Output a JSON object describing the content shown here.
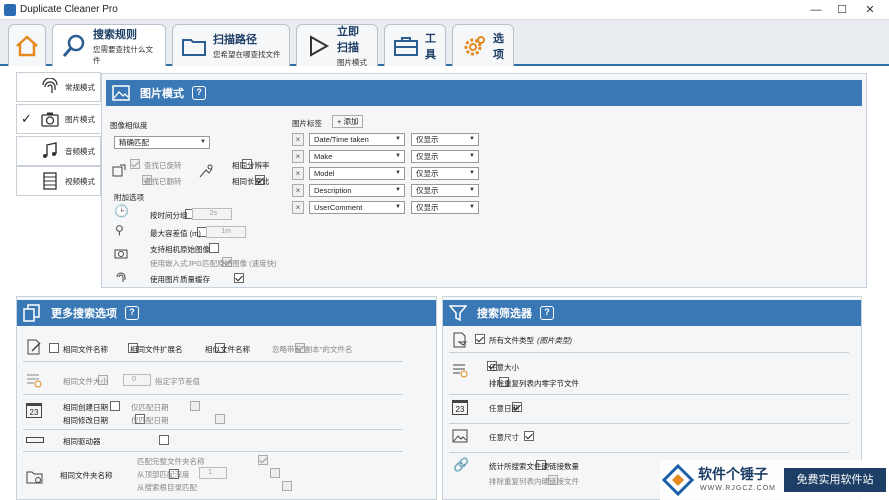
{
  "window": {
    "title": "Duplicate Cleaner Pro",
    "min": "—",
    "max": "☐",
    "close": "✕"
  },
  "tabs": [
    {
      "name": "",
      "sub": ""
    },
    {
      "name": "搜索规则",
      "sub": "您需要查找什么文件"
    },
    {
      "name": "扫描路径",
      "sub": "您希望在哪查找文件"
    },
    {
      "name": "立即扫描",
      "sub": "图片模式"
    },
    {
      "name": "工具",
      "sub": ""
    },
    {
      "name": "选项",
      "sub": ""
    }
  ],
  "modes": [
    "常规模式",
    "图片模式",
    "音频模式",
    "视频模式"
  ],
  "image_panel": {
    "title": "图片模式",
    "similarity_label": "图像相似度",
    "similarity_value": "精确匹配",
    "find_rotated": "查找已旋转",
    "find_flipped": "查找已翻转",
    "same_resolution": "相同分辨率",
    "same_aspect": "相同长宽比",
    "extra_label": "附加选项",
    "time_group": "按时间分组",
    "time_value": "2s",
    "max_distance": "最大容差值 (m)",
    "distance_value": "1m",
    "camera_raw": "支持相机原始图像",
    "embedded_jpg": "使用嵌入式JPG匹配原始图像 (速度快)",
    "cache": "使用图片质量缓存",
    "tags_label": "图片标签",
    "add_label": "+ 添加",
    "tags": [
      {
        "tag": "Date/Time taken",
        "mode": "仅显示"
      },
      {
        "tag": "Make",
        "mode": "仅显示"
      },
      {
        "tag": "Model",
        "mode": "仅显示"
      },
      {
        "tag": "Description",
        "mode": "仅显示"
      },
      {
        "tag": "UserComment",
        "mode": "仅显示"
      }
    ]
  },
  "more_panel": {
    "title": "更多搜索选项",
    "same_name": "相同文件名称",
    "same_ext": "相同文件扩展名",
    "similar_name": "相似文件名称",
    "ignore_copy": "忽略带有\"副本\"的文件名",
    "same_size": "相同文件大小",
    "size_value": "0",
    "size_diff": "指定字节差值",
    "same_created": "相同创建日期",
    "same_modified": "相同修改日期",
    "only_date1": "仅匹配日期",
    "only_date2": "仅匹配日期",
    "same_drive": "相同驱动器",
    "same_folder": "相同文件夹名称",
    "full_folder": "匹配完整文件夹名称",
    "from_top": "从顶部匹配深度",
    "depth_value": "1",
    "from_search": "从搜索根目录匹配"
  },
  "filter_panel": {
    "title": "搜索筛选器",
    "all_types": "所有文件类型",
    "all_types_note": "(图片类型)",
    "any_size": "任意大小",
    "exclude_zero": "排除重复列表内零字节文件",
    "any_date": "任意日期",
    "any_dimension": "任意尺寸",
    "hardlinks": "统计所搜索文件硬链接数量",
    "exclude_hardlinks": "排除重复列表内硬链接文件"
  },
  "watermark": {
    "brand": "软件个锤子",
    "url": "WWW.RJGCZ.COM",
    "slogan": "免费实用软件站"
  },
  "colors": {
    "accent": "#3a78b5",
    "tab_border": "#2f6ea6"
  }
}
